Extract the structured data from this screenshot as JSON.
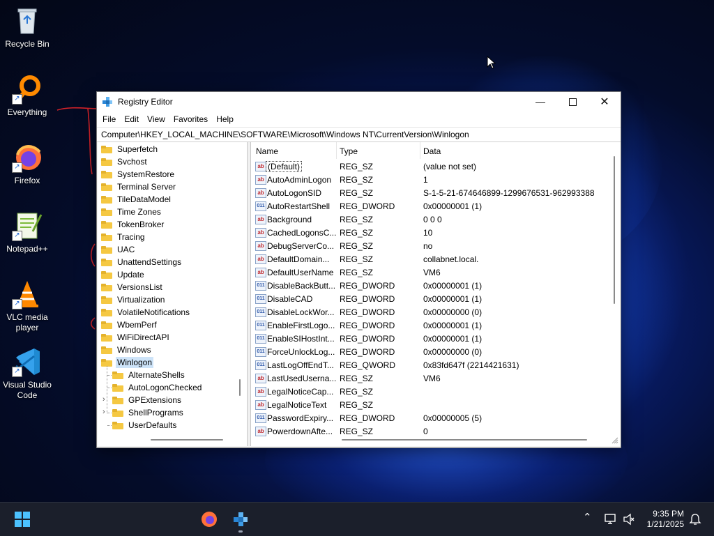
{
  "desktop": {
    "icons": [
      {
        "label": "Recycle Bin",
        "icon": "recycle-bin-icon"
      },
      {
        "label": "Everything",
        "icon": "everything-search-icon"
      },
      {
        "label": "Firefox",
        "icon": "firefox-icon"
      },
      {
        "label": "Notepad++",
        "icon": "notepad-plus-plus-icon"
      },
      {
        "label": "VLC media player",
        "icon": "vlc-icon"
      },
      {
        "label": "Visual Studio Code",
        "icon": "vscode-icon"
      }
    ]
  },
  "window": {
    "title": "Registry Editor",
    "menu": [
      "File",
      "Edit",
      "View",
      "Favorites",
      "Help"
    ],
    "address": "Computer\\HKEY_LOCAL_MACHINE\\SOFTWARE\\Microsoft\\Windows NT\\CurrentVersion\\Winlogon",
    "tree": {
      "items": [
        {
          "label": "Superfetch"
        },
        {
          "label": "Svchost"
        },
        {
          "label": "SystemRestore"
        },
        {
          "label": "Terminal Server"
        },
        {
          "label": "TileDataModel"
        },
        {
          "label": "Time Zones"
        },
        {
          "label": "TokenBroker"
        },
        {
          "label": "Tracing"
        },
        {
          "label": "UAC"
        },
        {
          "label": "UnattendSettings"
        },
        {
          "label": "Update"
        },
        {
          "label": "VersionsList"
        },
        {
          "label": "Virtualization"
        },
        {
          "label": "VolatileNotifications"
        },
        {
          "label": "WbemPerf"
        },
        {
          "label": "WiFiDirectAPI"
        },
        {
          "label": "Windows"
        },
        {
          "label": "Winlogon"
        }
      ],
      "children": [
        {
          "label": "AlternateShells",
          "expandable": false
        },
        {
          "label": "AutoLogonChecked",
          "expandable": false
        },
        {
          "label": "GPExtensions",
          "expandable": true
        },
        {
          "label": "ShellPrograms",
          "expandable": true
        },
        {
          "label": "UserDefaults",
          "expandable": false
        }
      ],
      "selected": "Winlogon"
    },
    "columns": {
      "name": "Name",
      "type": "Type",
      "data": "Data"
    },
    "values": [
      {
        "name": "(Default)",
        "type": "REG_SZ",
        "data": "(value not set)",
        "icon": "ab"
      },
      {
        "name": "AutoAdminLogon",
        "type": "REG_SZ",
        "data": "1",
        "icon": "ab"
      },
      {
        "name": "AutoLogonSID",
        "type": "REG_SZ",
        "data": "S-1-5-21-674646899-1299676531-962993388",
        "icon": "ab"
      },
      {
        "name": "AutoRestartShell",
        "type": "REG_DWORD",
        "data": "0x00000001 (1)",
        "icon": "dw"
      },
      {
        "name": "Background",
        "type": "REG_SZ",
        "data": "0 0 0",
        "icon": "ab"
      },
      {
        "name": "CachedLogonsC...",
        "type": "REG_SZ",
        "data": "10",
        "icon": "ab"
      },
      {
        "name": "DebugServerCo...",
        "type": "REG_SZ",
        "data": "no",
        "icon": "ab"
      },
      {
        "name": "DefaultDomain...",
        "type": "REG_SZ",
        "data": "collabnet.local.",
        "icon": "ab"
      },
      {
        "name": "DefaultUserName",
        "type": "REG_SZ",
        "data": "VM6",
        "icon": "ab"
      },
      {
        "name": "DisableBackButt...",
        "type": "REG_DWORD",
        "data": "0x00000001 (1)",
        "icon": "dw"
      },
      {
        "name": "DisableCAD",
        "type": "REG_DWORD",
        "data": "0x00000001 (1)",
        "icon": "dw"
      },
      {
        "name": "DisableLockWor...",
        "type": "REG_DWORD",
        "data": "0x00000000 (0)",
        "icon": "dw"
      },
      {
        "name": "EnableFirstLogo...",
        "type": "REG_DWORD",
        "data": "0x00000001 (1)",
        "icon": "dw"
      },
      {
        "name": "EnableSIHostInt...",
        "type": "REG_DWORD",
        "data": "0x00000001 (1)",
        "icon": "dw"
      },
      {
        "name": "ForceUnlockLog...",
        "type": "REG_DWORD",
        "data": "0x00000000 (0)",
        "icon": "dw"
      },
      {
        "name": "LastLogOffEndT...",
        "type": "REG_QWORD",
        "data": "0x83fd647f (2214421631)",
        "icon": "dw"
      },
      {
        "name": "LastUsedUserna...",
        "type": "REG_SZ",
        "data": "VM6",
        "icon": "ab"
      },
      {
        "name": "LegalNoticeCap...",
        "type": "REG_SZ",
        "data": "",
        "icon": "ab"
      },
      {
        "name": "LegalNoticeText",
        "type": "REG_SZ",
        "data": "",
        "icon": "ab"
      },
      {
        "name": "PasswordExpiry...",
        "type": "REG_DWORD",
        "data": "0x00000005 (5)",
        "icon": "dw"
      },
      {
        "name": "PowerdownAfte...",
        "type": "REG_SZ",
        "data": "0",
        "icon": "ab"
      }
    ]
  },
  "taskbar": {
    "time": "9:35 PM",
    "date": "1/21/2025",
    "pinned": [
      "start-icon",
      "firefox-icon",
      "registry-editor-icon"
    ],
    "tray": [
      "chevron-up-icon",
      "network-icon",
      "volume-muted-icon",
      "notification-bell-icon"
    ]
  },
  "colors": {
    "accent": "#0067c0",
    "taskbar": "#1b1f2b",
    "selection": "#cde3f8"
  }
}
